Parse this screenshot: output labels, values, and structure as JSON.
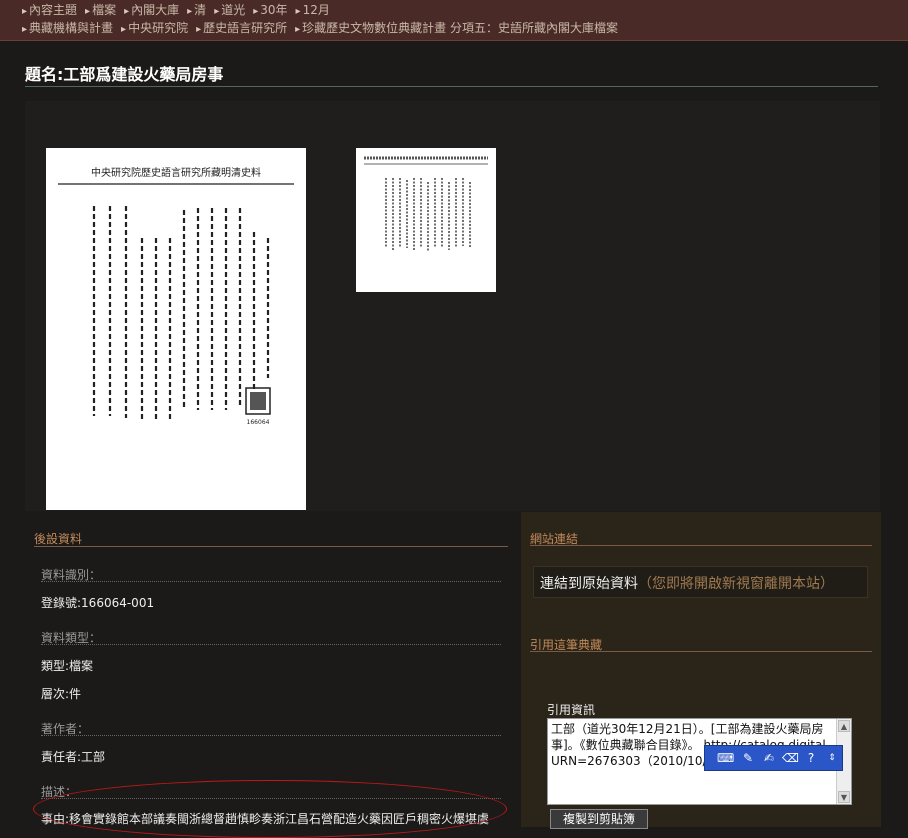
{
  "breadcrumbs": {
    "row1": [
      "內容主題",
      "檔案",
      "內閣大庫",
      "清",
      "道光",
      "30年",
      "12月"
    ],
    "row2": [
      "典藏機構與計畫",
      "中央研究院",
      "歷史語言研究所",
      "珍藏歷史文物數位典藏計畫 分項五：史語所藏內閣大庫檔案"
    ]
  },
  "page_title": "題名:工部爲建設火藥局房事",
  "metadata": {
    "section_title": "後設資料",
    "id_label": "資料識別：",
    "id_value": "登錄號:166064-001",
    "type_label": "資料類型：",
    "type_value": "類型:檔案",
    "level_value": "層次:件",
    "author_label": "著作者：",
    "author_value": "責任者:工部",
    "desc_label": "描述：",
    "desc_value": "事由:移會實錄館本部議奏閩浙總督趙慎畛奏浙江昌石營配造火藥因匠戶稠密火爆堪虞"
  },
  "links": {
    "section_title": "網站連結",
    "link_text": "連結到原始資料",
    "link_note": "（您即將開啟新視窗離開本站）"
  },
  "citation": {
    "section_title": "引用這筆典藏",
    "label": "引用資訊",
    "text": "工部（道光30年12月21日）。[工部為建設火藥局房事]。《數位典藏聯合目錄》。 http://catalog.digital URN=2676303（2010/10/11瀏覽）。",
    "copy_button": "複製到剪貼簿"
  },
  "document_image": {
    "header_text": "中央研究院歷史語言研究所藏明清史料",
    "stamp_number": "166064"
  }
}
